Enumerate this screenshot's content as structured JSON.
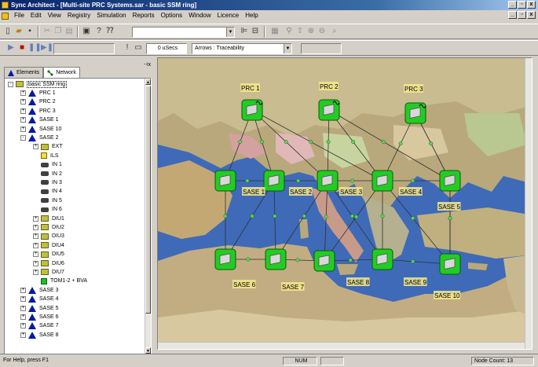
{
  "window": {
    "title": "Sync Architect - [Multi-site PRC Systems.sar - basic SSM ring]"
  },
  "menu": [
    "File",
    "Edit",
    "View",
    "Registry",
    "Simulation",
    "Reports",
    "Options",
    "Window",
    "Licence",
    "Help"
  ],
  "toolbar2": {
    "time_value": "0 uSecs",
    "arrows_select": "Arrows : Traceability"
  },
  "panel": {
    "tabs": [
      "Elements",
      "Network"
    ],
    "active_tab": "Network",
    "tree": [
      {
        "label": "basic SSM ring",
        "icon": "network-icon",
        "depth": 0,
        "expander": "-"
      },
      {
        "label": "PRC 1",
        "icon": "node-triangle-icon",
        "depth": 1,
        "expander": "+"
      },
      {
        "label": "PRC 2",
        "icon": "node-triangle-icon",
        "depth": 1,
        "expander": "+"
      },
      {
        "label": "PRC 3",
        "icon": "node-triangle-icon",
        "depth": 1,
        "expander": "+"
      },
      {
        "label": "SASE 1",
        "icon": "node-triangle-icon",
        "depth": 1,
        "expander": "+"
      },
      {
        "label": "SASE 10",
        "icon": "node-triangle-icon",
        "depth": 1,
        "expander": "+"
      },
      {
        "label": "SASE 2",
        "icon": "node-triangle-icon",
        "depth": 1,
        "expander": "-"
      },
      {
        "label": "EXT",
        "icon": "folder-icon",
        "depth": 2,
        "expander": "+"
      },
      {
        "label": "ILS",
        "icon": "yellow-module-icon",
        "depth": 2,
        "expander": ""
      },
      {
        "label": "IN 1",
        "icon": "input-device-icon",
        "depth": 2,
        "expander": ""
      },
      {
        "label": "IN 2",
        "icon": "input-device-icon",
        "depth": 2,
        "expander": ""
      },
      {
        "label": "IN 3",
        "icon": "input-device-icon",
        "depth": 2,
        "expander": ""
      },
      {
        "label": "IN 4",
        "icon": "input-device-icon",
        "depth": 2,
        "expander": ""
      },
      {
        "label": "IN 5",
        "icon": "input-device-icon",
        "depth": 2,
        "expander": ""
      },
      {
        "label": "IN 6",
        "icon": "input-device-icon",
        "depth": 2,
        "expander": ""
      },
      {
        "label": "DIU1",
        "icon": "folder-icon",
        "depth": 2,
        "expander": "+"
      },
      {
        "label": "DIU2",
        "icon": "folder-icon",
        "depth": 2,
        "expander": "+"
      },
      {
        "label": "DIU3",
        "icon": "folder-icon",
        "depth": 2,
        "expander": "+"
      },
      {
        "label": "DIU4",
        "icon": "folder-icon",
        "depth": 2,
        "expander": "+"
      },
      {
        "label": "DIU5",
        "icon": "folder-icon",
        "depth": 2,
        "expander": "+"
      },
      {
        "label": "DIU6",
        "icon": "folder-icon",
        "depth": 2,
        "expander": "+"
      },
      {
        "label": "DIU7",
        "icon": "folder-icon",
        "depth": 2,
        "expander": "+"
      },
      {
        "label": "TOM1-2 + BVA",
        "icon": "green-module-icon",
        "depth": 2,
        "expander": ""
      },
      {
        "label": "SASE 3",
        "icon": "node-triangle-icon",
        "depth": 1,
        "expander": "+"
      },
      {
        "label": "SASE 4",
        "icon": "node-triangle-icon",
        "depth": 1,
        "expander": "+"
      },
      {
        "label": "SASE 5",
        "icon": "node-triangle-icon",
        "depth": 1,
        "expander": "+"
      },
      {
        "label": "SASE 6",
        "icon": "node-triangle-icon",
        "depth": 1,
        "expander": "+"
      },
      {
        "label": "SASE 7",
        "icon": "node-triangle-icon",
        "depth": 1,
        "expander": "+"
      },
      {
        "label": "SASE 8",
        "icon": "node-triangle-icon",
        "depth": 1,
        "expander": "+"
      }
    ]
  },
  "map": {
    "nodes": [
      {
        "id": "PRC1",
        "label": "PRC 1",
        "kind": "prc"
      },
      {
        "id": "PRC2",
        "label": "PRC 2",
        "kind": "prc"
      },
      {
        "id": "PRC3",
        "label": "PRC 3",
        "kind": "prc"
      },
      {
        "id": "SASE1",
        "label": "SASE 1",
        "kind": "sase"
      },
      {
        "id": "SASE2",
        "label": "SASE 2",
        "kind": "sase"
      },
      {
        "id": "SASE3",
        "label": "SASE 3",
        "kind": "sase"
      },
      {
        "id": "SASE4",
        "label": "SASE 4",
        "kind": "sase"
      },
      {
        "id": "SASE5",
        "label": "SASE 5",
        "kind": "sase"
      },
      {
        "id": "SASE11",
        "label": "",
        "kind": "sase"
      },
      {
        "id": "SASE6",
        "label": "SASE 6",
        "kind": "sase"
      },
      {
        "id": "SASE7",
        "label": "SASE 7",
        "kind": "sase"
      },
      {
        "id": "SASEx",
        "label": "",
        "kind": "sase"
      },
      {
        "id": "SASE8",
        "label": "SASE 8",
        "kind": "sase"
      },
      {
        "id": "SASE9",
        "label": "SASE 9",
        "kind": "sase"
      },
      {
        "id": "SASE10",
        "label": "SASE 10",
        "kind": "sase"
      }
    ],
    "links": [
      [
        "PRC1",
        "SASE11"
      ],
      [
        "PRC1",
        "SASE1"
      ],
      [
        "PRC1",
        "SASE2"
      ],
      [
        "PRC1",
        "SASE3"
      ],
      [
        "PRC2",
        "SASE2"
      ],
      [
        "PRC2",
        "SASE3"
      ],
      [
        "PRC2",
        "SASE4"
      ],
      [
        "PRC3",
        "SASE3"
      ],
      [
        "PRC3",
        "SASE4"
      ],
      [
        "PRC3",
        "SASE5"
      ],
      [
        "SASE11",
        "SASE1"
      ],
      [
        "SASE1",
        "SASE2"
      ],
      [
        "SASE2",
        "SASE3"
      ],
      [
        "SASE3",
        "SASE4"
      ],
      [
        "SASE4",
        "SASE5"
      ],
      [
        "SASE11",
        "SASE6"
      ],
      [
        "SASE1",
        "SASE6"
      ],
      [
        "SASE1",
        "SASE7"
      ],
      [
        "SASE2",
        "SASE7"
      ],
      [
        "SASE2",
        "SASEx"
      ],
      [
        "SASE2",
        "SASE8"
      ],
      [
        "SASE3",
        "SASEx"
      ],
      [
        "SASE3",
        "SASE8"
      ],
      [
        "SASE3",
        "SASE9"
      ],
      [
        "SASE4",
        "SASE9"
      ],
      [
        "SASE4",
        "SASE10"
      ],
      [
        "SASE5",
        "SASE10"
      ],
      [
        "SASE6",
        "SASE7"
      ],
      [
        "SASE7",
        "SASEx"
      ],
      [
        "SASEx",
        "SASE8"
      ],
      [
        "SASE8",
        "SASE10"
      ]
    ],
    "colors": {
      "sea": "#3f6ab8",
      "node": "#22cc22",
      "node_border": "#0a5a0a",
      "link": "#303030",
      "label_bg": "#f4e88c"
    }
  },
  "status": {
    "help": "For Help, press F1",
    "num": "NUM",
    "node_count": "Node Count: 13"
  }
}
